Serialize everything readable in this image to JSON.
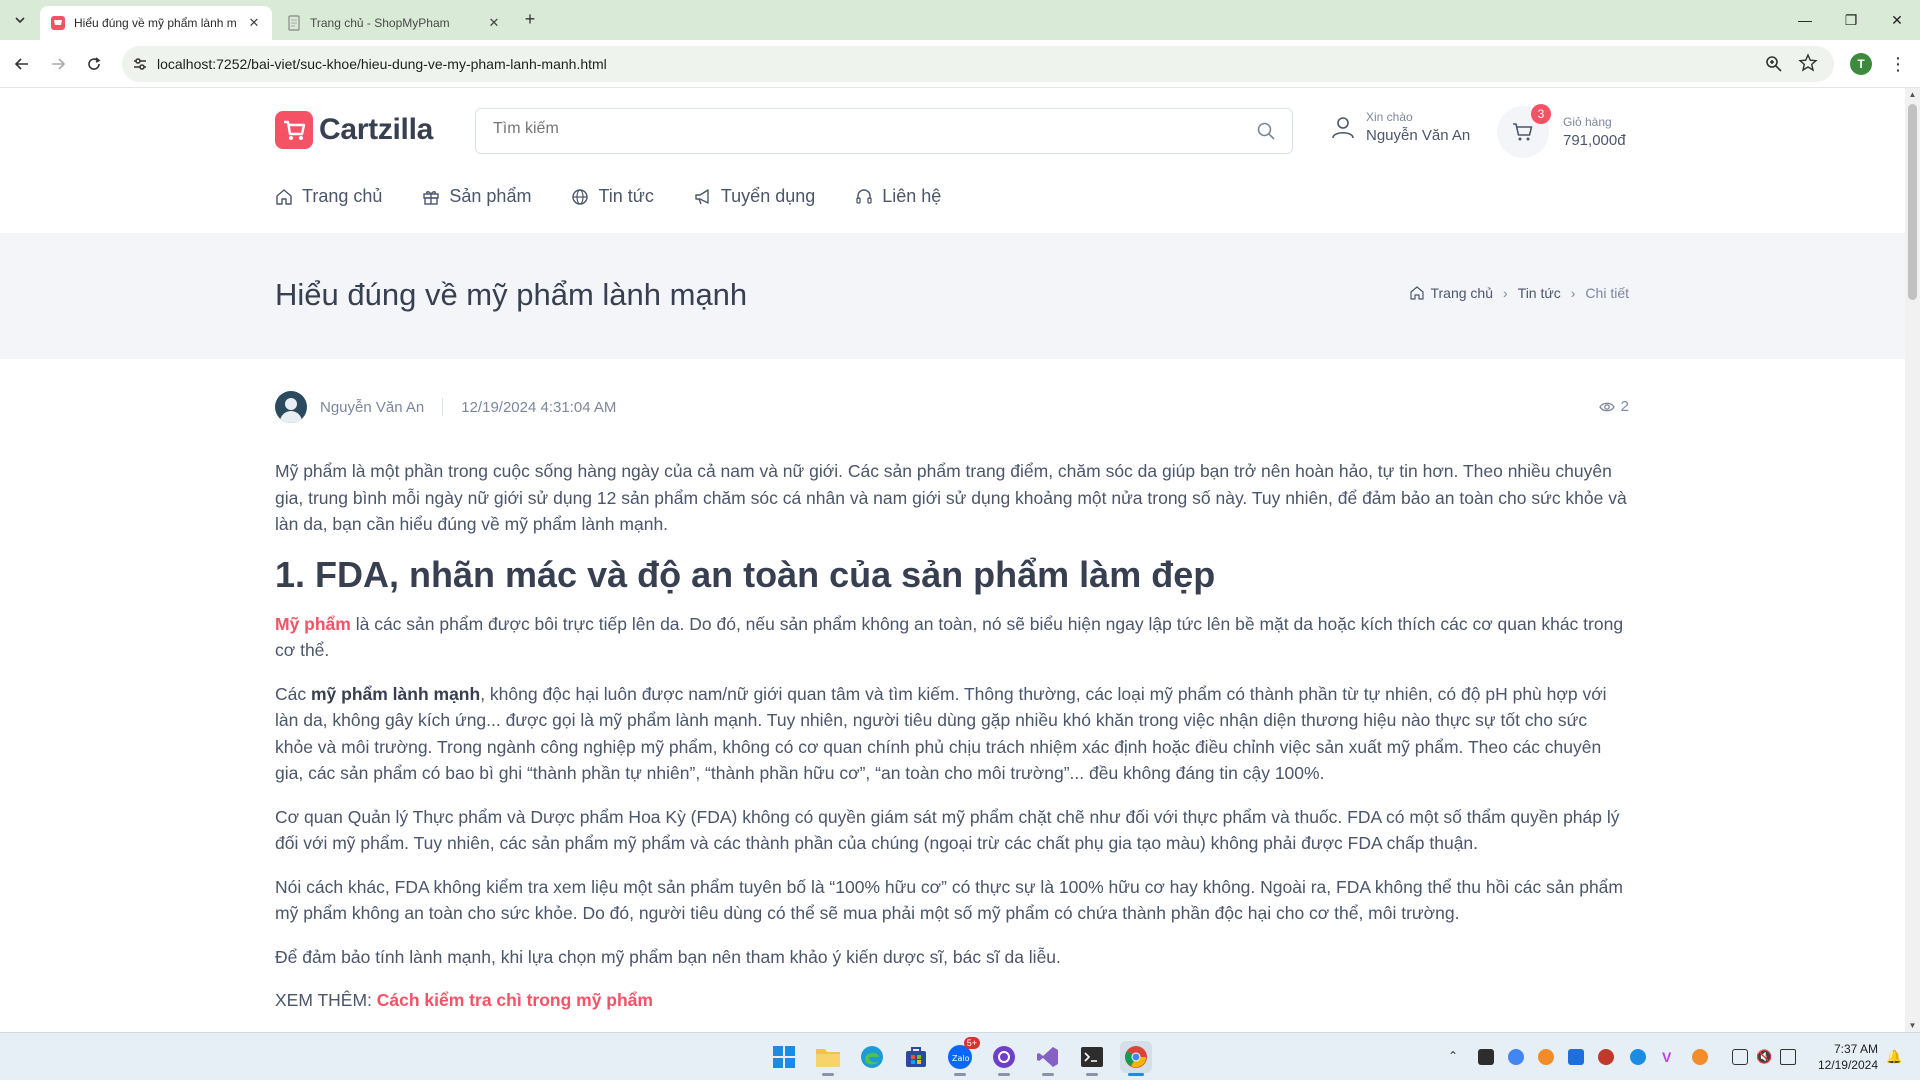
{
  "browser": {
    "tabs": [
      {
        "title": "Hiểu đúng về mỹ phẩm lành m",
        "active": true
      },
      {
        "title": "Trang chủ - ShopMyPham",
        "active": false
      }
    ],
    "url": "localhost:7252/bai-viet/suc-khoe/hieu-dung-ve-my-pham-lanh-manh.html",
    "profile_initial": "T"
  },
  "header": {
    "logo_text": "Cartzilla",
    "search_placeholder": "Tìm kiếm",
    "account": {
      "greeting": "Xin chào",
      "name": "Nguyễn Văn An"
    },
    "cart": {
      "label": "Giỏ hàng",
      "total": "791,000đ",
      "count": "3"
    }
  },
  "nav": {
    "items": [
      {
        "label": "Trang chủ",
        "icon": "home-icon"
      },
      {
        "label": "Sản phẩm",
        "icon": "gift-icon"
      },
      {
        "label": "Tin tức",
        "icon": "globe-icon"
      },
      {
        "label": "Tuyển dụng",
        "icon": "megaphone-icon"
      },
      {
        "label": "Liên hệ",
        "icon": "headset-icon"
      }
    ]
  },
  "page": {
    "title": "Hiểu đúng về mỹ phẩm lành mạnh",
    "breadcrumb": [
      "Trang chủ",
      "Tin tức",
      "Chi tiết"
    ]
  },
  "post": {
    "author": "Nguyễn Văn An",
    "date": "12/19/2024 4:31:04 AM",
    "views": "2"
  },
  "article": {
    "intro": "Mỹ phẩm là một phần trong cuộc sống hàng ngày của cả nam và nữ giới. Các sản phẩm trang điểm, chăm sóc da giúp bạn trở nên hoàn hảo, tự tin hơn. Theo nhiều chuyên gia, trung bình mỗi ngày nữ giới sử dụng 12 sản phẩm chăm sóc cá nhân và nam giới sử dụng khoảng một nửa trong số này. Tuy nhiên, để đảm bảo an toàn cho sức khỏe và làn da, bạn cần hiểu đúng về mỹ phẩm lành mạnh.",
    "heading1": "1. FDA, nhãn mác và độ an toàn của sản phẩm làm đẹp",
    "p1_link": "Mỹ phẩm",
    "p1_rest": " là các sản phẩm được bôi trực tiếp lên da. Do đó, nếu sản phẩm không an toàn, nó sẽ biểu hiện ngay lập tức lên bề mặt da hoặc kích thích các cơ quan khác trong cơ thể.",
    "p2_pre": "Các ",
    "p2_bold": "mỹ phẩm lành mạnh",
    "p2_rest": ", không độc hại luôn được nam/nữ giới quan tâm và tìm kiếm. Thông thường, các loại mỹ phẩm có thành phần từ tự nhiên, có độ pH phù hợp với làn da, không gây kích ứng... được gọi là mỹ phẩm lành mạnh. Tuy nhiên, người tiêu dùng gặp nhiều khó khăn trong việc nhận diện thương hiệu nào thực sự tốt cho sức khỏe và môi trường. Trong ngành công nghiệp mỹ phẩm, không có cơ quan chính phủ chịu trách nhiệm xác định hoặc điều chỉnh việc sản xuất mỹ phẩm. Theo các chuyên gia, các sản phẩm có bao bì ghi “thành phần tự nhiên”, “thành phần hữu cơ”, “an toàn cho môi trường”... đều không đáng tin cậy 100%.",
    "p3": "Cơ quan Quản lý Thực phẩm và Dược phẩm Hoa Kỳ (FDA) không có quyền giám sát mỹ phẩm chặt chẽ như đối với thực phẩm và thuốc. FDA có một số thẩm quyền pháp lý đối với mỹ phẩm. Tuy nhiên, các sản phẩm mỹ phẩm và các thành phần của chúng (ngoại trừ các chất phụ gia tạo màu) không phải được FDA chấp thuận.",
    "p4": "Nói cách khác, FDA không kiểm tra xem liệu một sản phẩm tuyên bố là “100% hữu cơ” có thực sự là 100% hữu cơ hay không. Ngoài ra, FDA không thể thu hồi các sản phẩm mỹ phẩm không an toàn cho sức khỏe. Do đó, người tiêu dùng có thể sẽ mua phải một số mỹ phẩm có chứa thành phần độc hại cho cơ thể, môi trường.",
    "p5": "Để đảm bảo tính lành mạnh, khi lựa chọn mỹ phẩm bạn nên tham khảo ý kiến dược sĩ, bác sĩ da liễu.",
    "see_more_label": "XEM THÊM: ",
    "see_more_link": "Cách kiểm tra chì trong mỹ phẩm"
  },
  "taskbar": {
    "time": "7:37 AM",
    "date": "12/19/2024",
    "zalo_badge": "5+"
  },
  "colors": {
    "accent": "#f55266",
    "heading": "#373f50",
    "body_text": "#4b566b",
    "band": "#f3f5f9"
  }
}
